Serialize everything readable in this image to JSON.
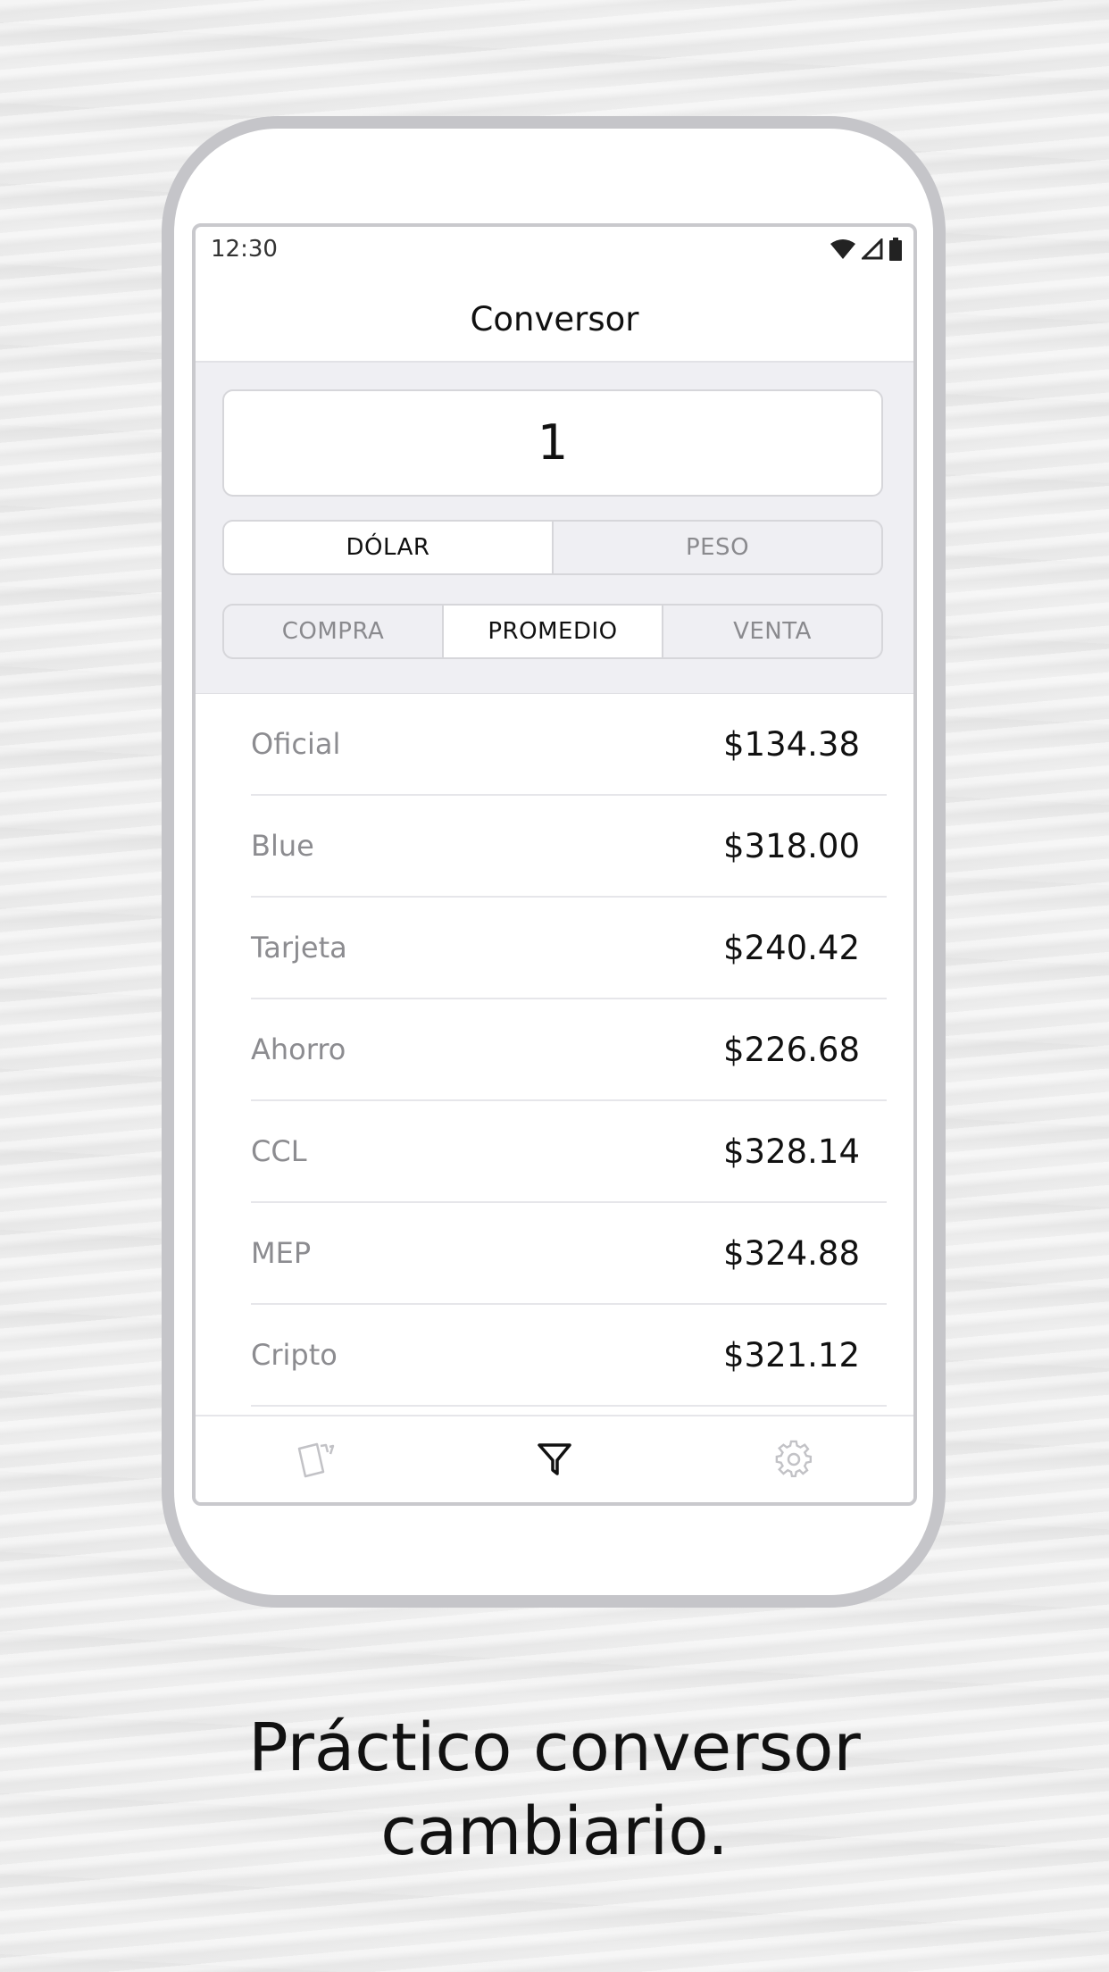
{
  "status_bar": {
    "time": "12:30"
  },
  "nav": {
    "title": "Conversor"
  },
  "amount": {
    "value": "1"
  },
  "currency_toggle": {
    "options": [
      "DÓLAR",
      "PESO"
    ],
    "selected": "DÓLAR"
  },
  "rate_toggle": {
    "options": [
      "COMPRA",
      "PROMEDIO",
      "VENTA"
    ],
    "selected": "PROMEDIO"
  },
  "rates": [
    {
      "name": "Oficial",
      "value": "$134.38"
    },
    {
      "name": "Blue",
      "value": "$318.00"
    },
    {
      "name": "Tarjeta",
      "value": "$240.42"
    },
    {
      "name": "Ahorro",
      "value": "$226.68"
    },
    {
      "name": "CCL",
      "value": "$328.14"
    },
    {
      "name": "MEP",
      "value": "$324.88"
    },
    {
      "name": "Cripto",
      "value": "$321.12"
    }
  ],
  "tabs": [
    {
      "icon": "cards-icon",
      "active": false
    },
    {
      "icon": "filter-icon",
      "active": true
    },
    {
      "icon": "gear-icon",
      "active": false
    }
  ],
  "caption": {
    "line1": "Práctico conversor",
    "line2": "cambiario."
  },
  "colors": {
    "accent": "#111111",
    "muted": "#8c8c90",
    "frame": "#c5c5c9"
  }
}
